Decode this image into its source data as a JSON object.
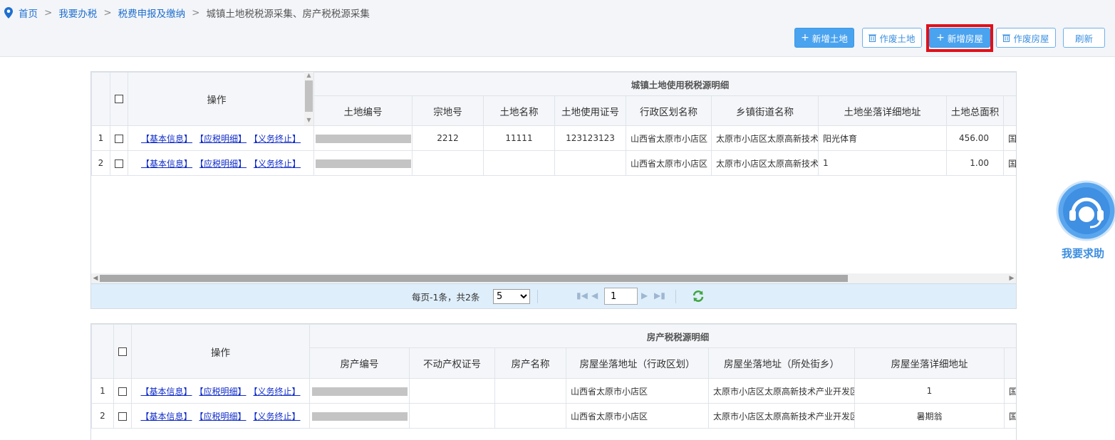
{
  "breadcrumb": {
    "items": [
      "首页",
      "我要办税",
      "税费申报及缴纳"
    ],
    "separator": ">",
    "current": "城镇土地税税源采集、房产税税源采集"
  },
  "toolbar": {
    "add_land": "新增土地",
    "void_land": "作废土地",
    "add_house": "新增房屋",
    "void_house": "作废房屋",
    "refresh": "刷新"
  },
  "land_grid": {
    "op_header": "操作",
    "group_header": "城镇土地使用税税源明细",
    "columns": [
      "土地编号",
      "宗地号",
      "土地名称",
      "土地使用证号",
      "行政区划名称",
      "乡镇街道名称",
      "土地坐落详细地址",
      "土地总面积"
    ],
    "links": [
      "【基本信息】",
      "【应税明细】",
      "【义务终止】"
    ],
    "rows": [
      {
        "no": "1",
        "zongdi": "2212",
        "name": "11111",
        "cert": "123123123",
        "district": "山西省太原市小店区",
        "street": "太原市小店区太原高新技术",
        "address": "阳光体育",
        "area": "456.00",
        "extra": "国"
      },
      {
        "no": "2",
        "zongdi": "",
        "name": "",
        "cert": "",
        "district": "山西省太原市小店区",
        "street": "太原市小店区太原高新技术",
        "address": "1",
        "area": "1.00",
        "extra": "国"
      }
    ],
    "pager": {
      "info": "每页-1条，共2条",
      "page_size": "5",
      "page_size_options": [
        "5"
      ],
      "current_page": "1"
    }
  },
  "house_grid": {
    "op_header": "操作",
    "group_header": "房产税税源明细",
    "columns": [
      "房产编号",
      "不动产权证号",
      "房产名称",
      "房屋坐落地址（行政区划）",
      "房屋坐落地址（所处街乡）",
      "房屋坐落详细地址"
    ],
    "links": [
      "【基本信息】",
      "【应税明细】",
      "【义务终止】"
    ],
    "rows": [
      {
        "no": "1",
        "cert": "",
        "name": "",
        "district": "山西省太原市小店区",
        "street": "太原市小店区太原高新技术产业开发区",
        "address": "1",
        "extra": "国"
      },
      {
        "no": "2",
        "cert": "",
        "name": "",
        "district": "山西省太原市小店区",
        "street": "太原市小店区太原高新技术产业开发区",
        "address": "暑期翁",
        "extra": "国"
      }
    ]
  },
  "help": {
    "label": "我要求助"
  },
  "colors": {
    "accent": "#4aa3ef",
    "link": "#0f2bc9",
    "highlight": "#e0101a",
    "pager_bg": "#dfeefb"
  }
}
